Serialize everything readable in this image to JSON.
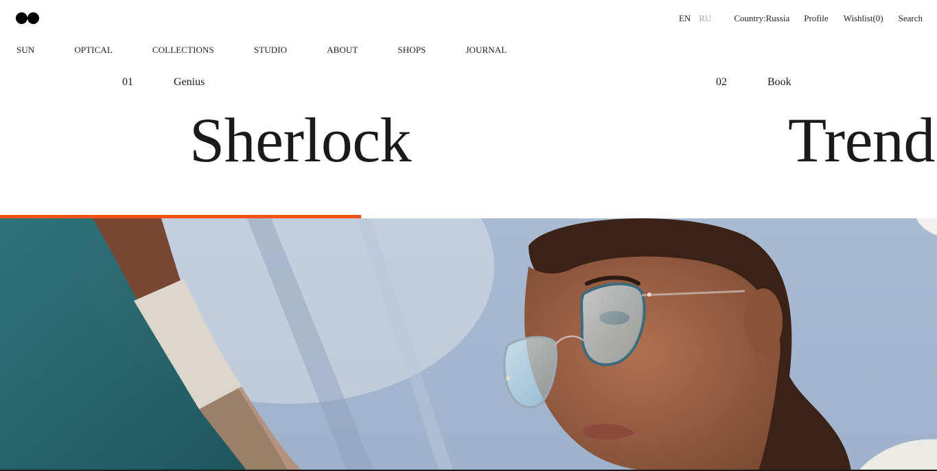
{
  "header": {
    "lang_en": "EN",
    "lang_ru": "RU",
    "country": "Country:Russia",
    "profile": "Profile",
    "wishlist": "Wishlist(0)",
    "search": "Search"
  },
  "nav": {
    "items": [
      "SUN",
      "OPTICAL",
      "COLLECTIONS",
      "STUDIO",
      "ABOUT",
      "SHOPS",
      "JOURNAL"
    ]
  },
  "slides": [
    {
      "number": "01",
      "category": "Genius",
      "title": "Sherlock"
    },
    {
      "number": "02",
      "category": "Book",
      "title": "Trend"
    }
  ],
  "slider": {
    "progress_fraction": 0.385,
    "accent_color": "#f25115"
  },
  "hero": {
    "image": "woman-wearing-cat-eye-glasses-photo"
  }
}
